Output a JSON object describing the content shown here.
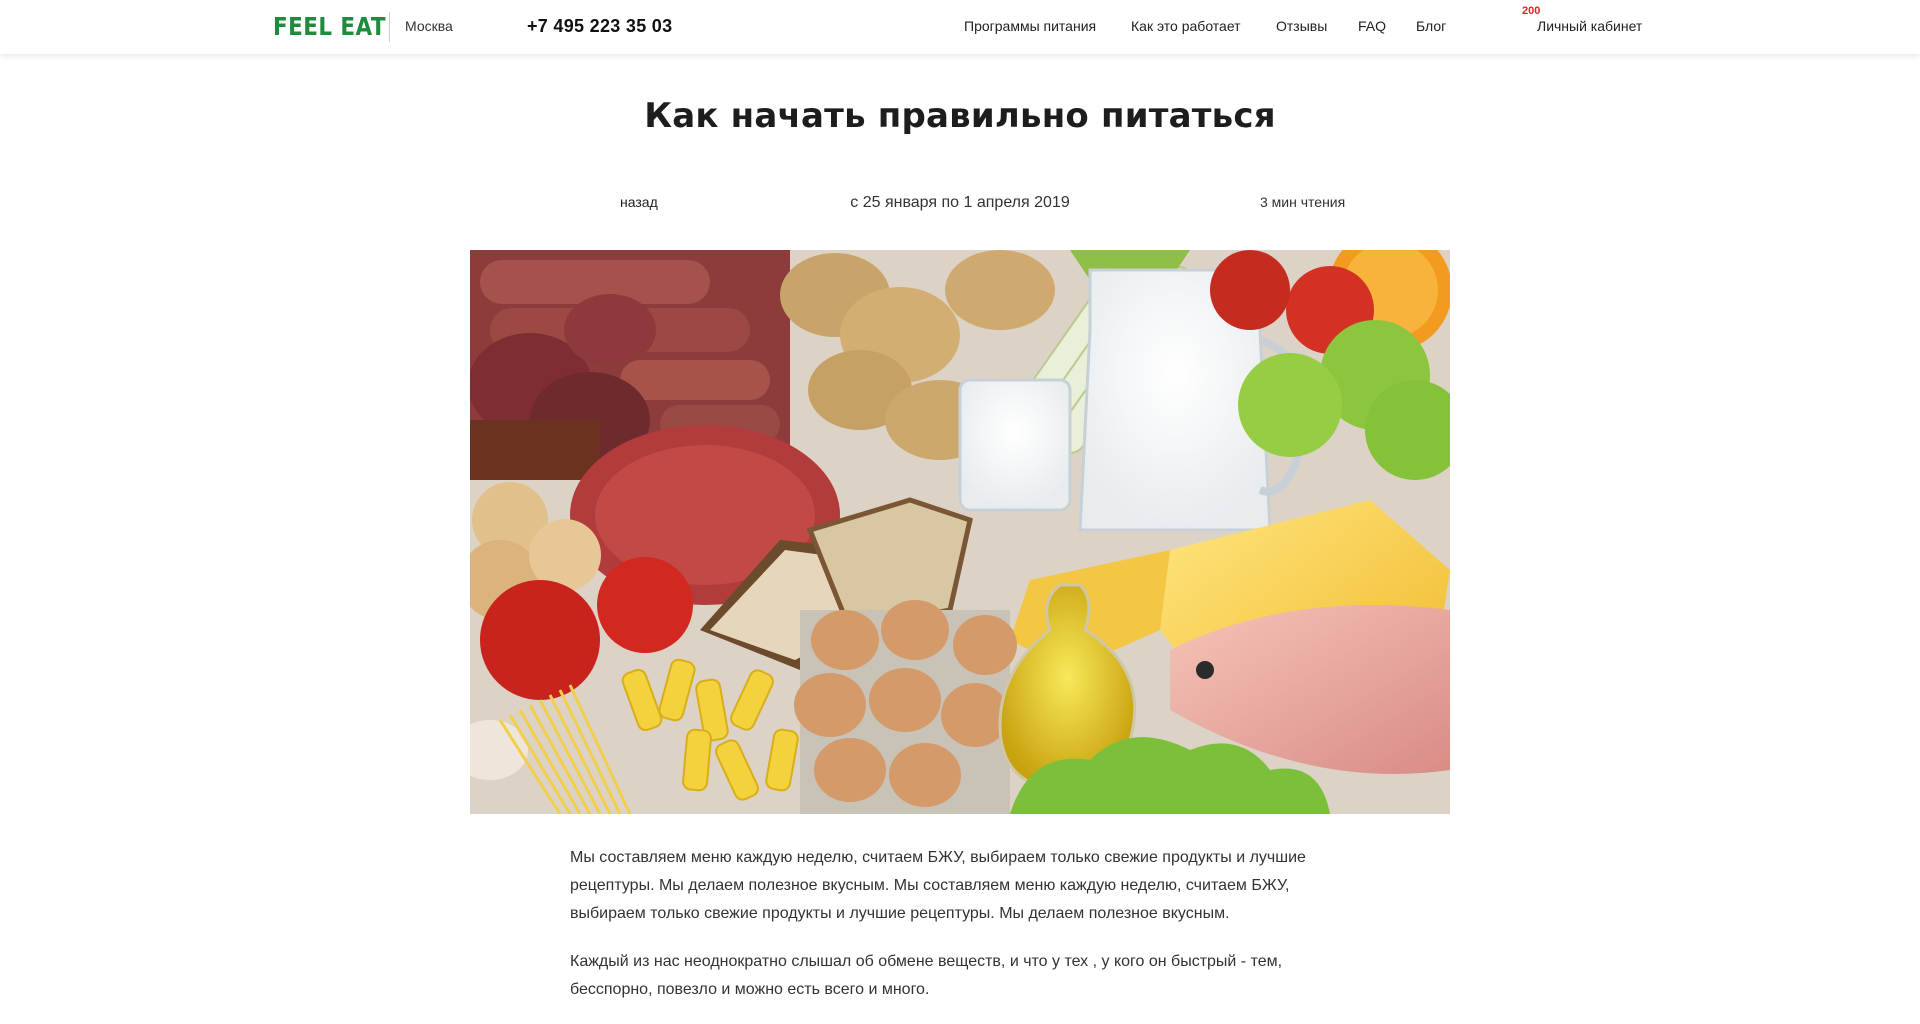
{
  "header": {
    "logo": "FEEL EAT",
    "city": "Москва",
    "phone": "+7 495 223 35 03",
    "nav": [
      "Программы питания",
      "Как это работает",
      "Отзывы",
      "FAQ",
      "Блог"
    ],
    "cabinet_badge": "200",
    "cabinet_label": "Личный кабинет",
    "brand_color": "#1e8c3c",
    "badge_color": "#e0231b"
  },
  "article": {
    "title": "Как начать правильно питаться",
    "back_label": "назад",
    "date_range": "с 25 января по 1 апреля 2019",
    "read_time": "3 мин чтения",
    "hero_image": "food-products-photo",
    "paragraphs": [
      "Мы составляем меню каждую неделю, считаем БЖУ, выбираем только свежие продукты и лучшие рецептуры. Мы делаем полезное вкусным. Мы составляем меню каждую неделю, считаем БЖУ, выбираем только свежие продукты и лучшие рецептуры. Мы делаем полезное вкусным.",
      "Каждый из нас неоднократно слышал об обмене веществ, и что у тех , у кого он быстрый - тем, бесспорно, повезло и можно есть всего и много."
    ]
  }
}
